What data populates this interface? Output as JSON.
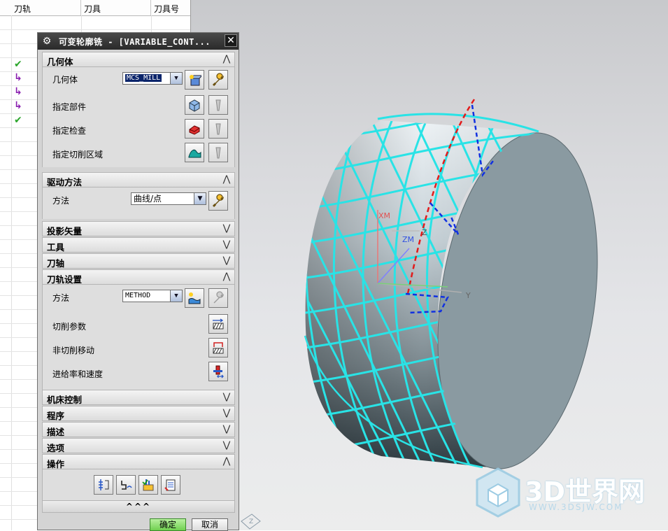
{
  "navigator": {
    "columns": [
      "刀轨",
      "刀具",
      "刀具号"
    ],
    "status_icons": [
      "check-icon",
      "redirect-icon",
      "redirect-icon",
      "redirect-icon",
      "check-icon"
    ],
    "colors": {
      "check": "#2aa52a",
      "redirect": "#8a1fb0"
    }
  },
  "dialog": {
    "title": "可变轮廓铣 - [VARIABLE_CONT...",
    "geometry": {
      "header": "几何体",
      "geometry_label": "几何体",
      "geometry_value": "MCS_MILL",
      "specify_part": "指定部件",
      "specify_check": "指定检查",
      "specify_cut_area": "指定切削区域"
    },
    "drive": {
      "header": "驱动方法",
      "method_label": "方法",
      "method_value": "曲线/点"
    },
    "collapsed_sections": {
      "projection": "投影矢量",
      "tool": "工具",
      "tool_axis": "刀轴"
    },
    "path_settings": {
      "header": "刀轨设置",
      "method_label": "方法",
      "method_value": "METHOD",
      "cut_params": "切削参数",
      "non_cut_moves": "非切削移动",
      "feeds_speeds": "进给率和速度"
    },
    "more_sections": {
      "machine_control": "机床控制",
      "program": "程序",
      "description": "描述",
      "options": "选项"
    },
    "actions": {
      "header": "操作"
    },
    "more_toggle": "^^^",
    "ok": "确定",
    "cancel": "取消"
  },
  "viewport": {
    "axis_labels": {
      "xm": "XM",
      "zm": "ZM",
      "z": "Z",
      "y": "Y"
    },
    "colors": {
      "toolpath": "#29e3e6",
      "drive_curve": "#e21b1b",
      "vector": "#1030e0",
      "solid_face": "#8a9aa1"
    }
  },
  "watermark": {
    "brand": "3D世界网",
    "url": "WWW.3DSJW.COM"
  }
}
